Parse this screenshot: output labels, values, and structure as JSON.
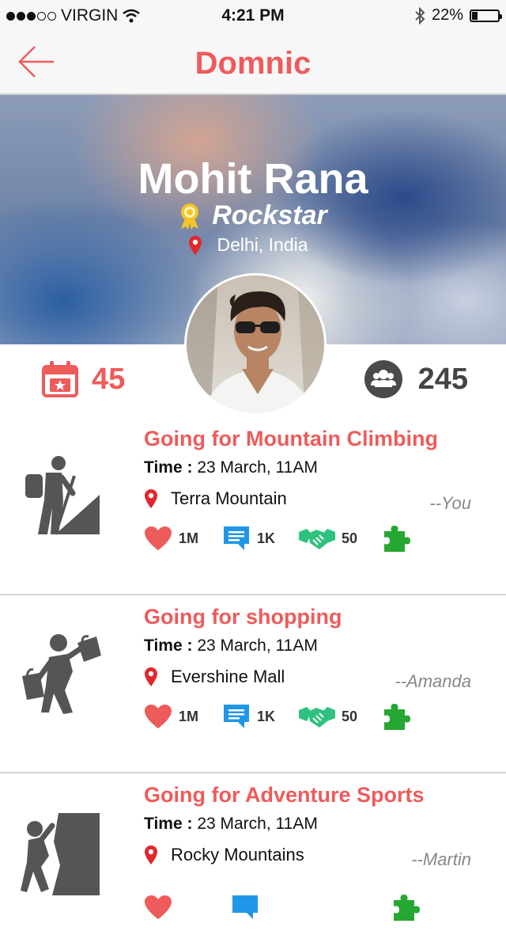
{
  "status_bar": {
    "carrier": "VIRGIN",
    "time": "4:21 PM",
    "battery": "22%",
    "battery_level": 0.22
  },
  "nav": {
    "back_icon": "arrow-left-icon",
    "title": "Domnic"
  },
  "profile": {
    "name": "Mohit Rana",
    "title": "Rockstar",
    "badge_icon": "award-ribbon-icon",
    "location": "Delhi, India",
    "events_count": "45",
    "friends_count": "245"
  },
  "feed": [
    {
      "title": "Going for Mountain Climbing",
      "time_label": "Time :",
      "time_value": "23 March, 11AM",
      "location": "Terra Mountain",
      "author": "--You",
      "likes": "1M",
      "comments": "1K",
      "joins": "50",
      "icon": "mountain-climber-icon"
    },
    {
      "title": "Going for shopping",
      "time_label": "Time :",
      "time_value": "23 March, 11AM",
      "location": "Evershine Mall",
      "author": "--Amanda",
      "likes": "1M",
      "comments": "1K",
      "joins": "50",
      "icon": "shopper-icon"
    },
    {
      "title": "Going for Adventure Sports",
      "time_label": "Time :",
      "time_value": "23 March, 11AM",
      "location": "Rocky Mountains",
      "author": "--Martin",
      "icon": "rock-climber-icon"
    }
  ],
  "colors": {
    "accent": "#ee5b5b",
    "heart": "#ee5b5b",
    "comment": "#1f97e8",
    "handshake": "#2ec27e",
    "puzzle": "#26a632",
    "badge": "#f3c623",
    "pin": "#e3262b"
  }
}
